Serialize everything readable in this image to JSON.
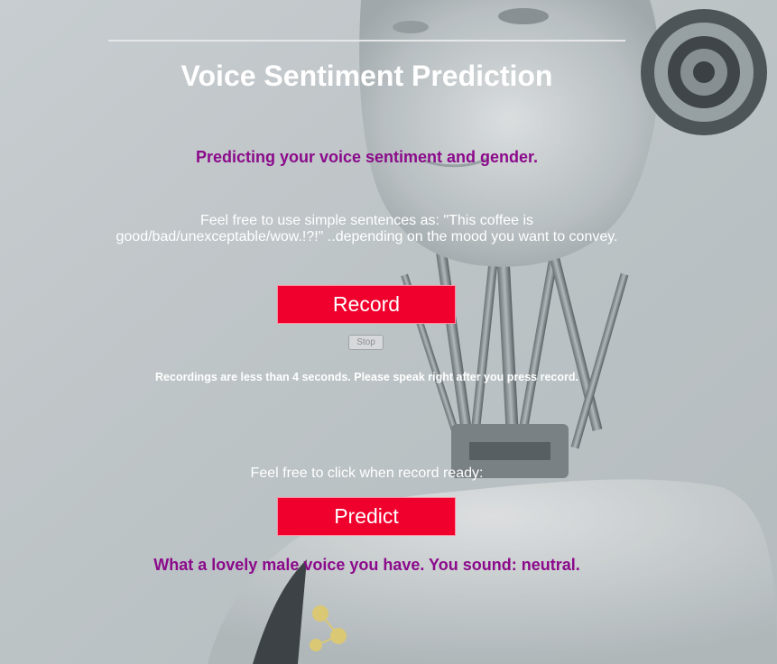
{
  "page": {
    "title": "Voice Sentiment Prediction",
    "subtitle": "Predicting your voice sentiment and gender.",
    "instructions_line1": "Feel free to use simple sentences as: \"This coffee is",
    "instructions_line2": "good/bad/unexceptable/wow.!?!\" ..depending on the mood you want to convey.",
    "record_label": "Record",
    "stop_label": "Stop",
    "recording_note": "Recordings are less than 4 seconds. Please speak right after you press record.",
    "click_note": "Feel free to click when record ready:",
    "predict_label": "Predict",
    "result_text": "What a lovely male voice you have. You sound: neutral."
  },
  "colors": {
    "accent_button": "#f0002c",
    "highlight_text": "#8b0a8b",
    "primary_text": "#ffffff",
    "background": "#b9c0c3"
  },
  "icons": {
    "background_image": "robot-portrait-image"
  }
}
